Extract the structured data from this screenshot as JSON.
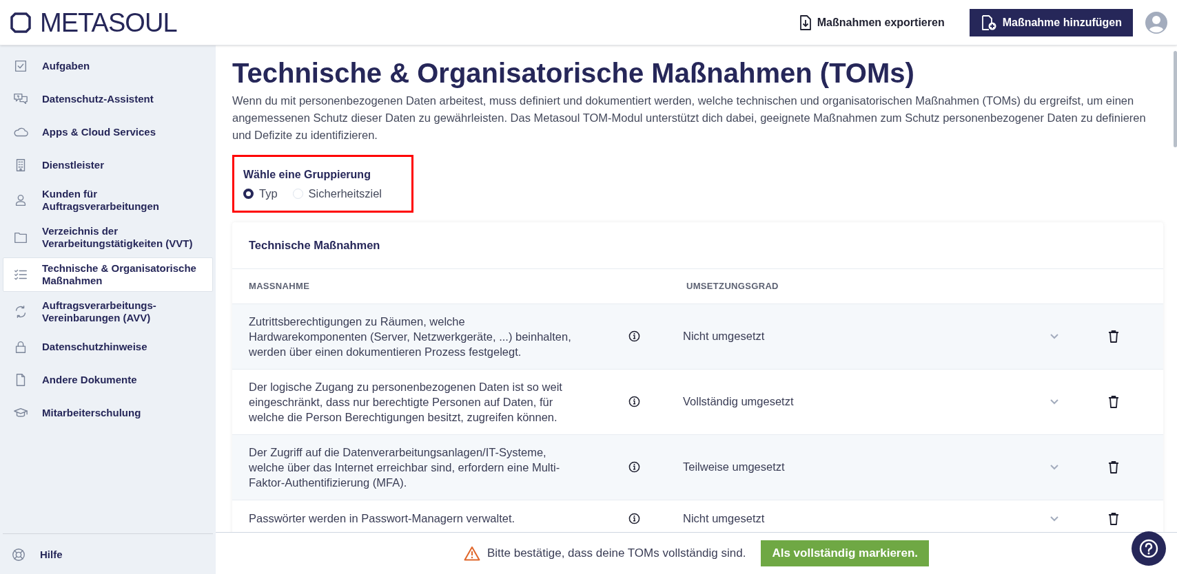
{
  "header": {
    "logo": "METASOUL",
    "export_button": "Maßnahmen exportieren",
    "add_button": "Maßnahme hinzufügen"
  },
  "sidebar": {
    "items": [
      {
        "label": "Aufgaben",
        "selected": false
      },
      {
        "label": "Datenschutz-Assistent",
        "selected": false
      },
      {
        "label": "Apps & Cloud Services",
        "selected": false
      },
      {
        "label": "Dienstleister",
        "selected": false
      },
      {
        "label": "Kunden für Auftragsverarbeitungen",
        "selected": false
      },
      {
        "label": "Verzeichnis der Verarbeitungstätigkeiten (VVT)",
        "selected": false
      },
      {
        "label": "Technische & Organisatorische Maßnahmen",
        "selected": true
      },
      {
        "label": "Auftragsverarbeitungs-Vereinbarungen (AVV)",
        "selected": false
      },
      {
        "label": "Datenschutzhinweise",
        "selected": false
      },
      {
        "label": "Andere Dokumente",
        "selected": false
      },
      {
        "label": "Mitarbeiterschulung",
        "selected": false
      }
    ],
    "help": "Hilfe"
  },
  "page": {
    "title": "Technische & Organisatorische Maßnahmen (TOMs)",
    "description": "Wenn du mit personenbezogenen Daten arbeitest, muss definiert und dokumentiert werden, welche technischen und organisatorischen Maßnahmen (TOMs) du ergreifst, um einen angemessenen Schutz dieser Daten zu gewährleisten. Das Metasoul TOM-Modul unterstützt dich dabei, geeignete Maßnahmen zum Schutz personenbezogener Daten zu definieren und Defizite zu identifizieren.",
    "grouping": {
      "label": "Wähle eine Gruppierung",
      "options": [
        {
          "label": "Typ",
          "selected": true
        },
        {
          "label": "Sicherheitsziel",
          "selected": false
        }
      ]
    },
    "card": {
      "title": "Technische Maßnahmen",
      "columns": [
        "MASSNAHME",
        "UMSETZUNGSGRAD"
      ],
      "rows": [
        {
          "measure": "Zutrittsberechtigungen zu Räumen, welche Hardwarekomponenten (Server, Netzwerkgeräte, ...) beinhalten, werden über einen dokumentieren Prozess festgelegt.",
          "status": "Nicht umgesetzt"
        },
        {
          "measure": "Der logische Zugang zu personenbezogenen Daten ist so weit eingeschränkt, dass nur berechtigte Personen auf Daten, für welche die Person Berechtigungen besitzt, zugreifen können.",
          "status": "Vollständig umgesetzt"
        },
        {
          "measure": "Der Zugriff auf die Datenverarbeitungsanlagen/IT-Systeme, welche über das Internet erreichbar sind, erfordern eine Multi-Faktor-Authentifizierung (MFA).",
          "status": "Teilweise umgesetzt"
        },
        {
          "measure": "Passwörter werden in Passwort-Managern verwaltet.",
          "status": "Nicht umgesetzt"
        }
      ]
    }
  },
  "footer": {
    "warning": "Bitte bestätige, dass deine TOMs vollständig sind.",
    "button": "Als vollständig markieren."
  }
}
